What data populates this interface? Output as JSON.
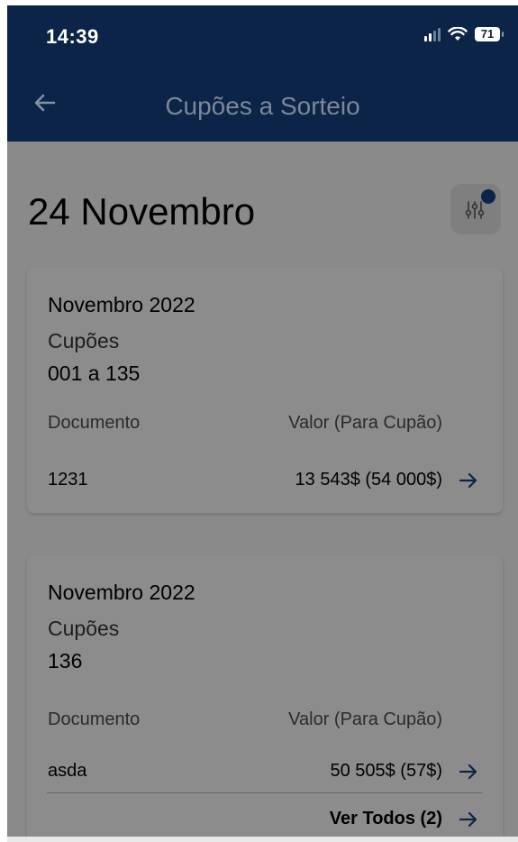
{
  "status": {
    "time": "14:39",
    "battery": "71"
  },
  "header": {
    "title": "Cupões a Sorteio"
  },
  "date_heading": "24 Novembro",
  "cards": [
    {
      "title": "Novembro 2022",
      "coupons_label": "Cupões",
      "coupons_range": "001 a 135",
      "col_document": "Documento",
      "col_value": "Valor (Para Cupão)",
      "document": "1231",
      "value": "13 543$ (54 000$)"
    },
    {
      "title": "Novembro 2022",
      "coupons_label": "Cupões",
      "coupons_range": "136",
      "col_document": "Documento",
      "col_value": "Valor (Para Cupão)",
      "document": "asda",
      "value": "50 505$ (57$)",
      "see_all": "Ver Todos (2)"
    }
  ],
  "colors": {
    "header_bg": "#0b2448",
    "accent": "#0b2448",
    "overlay": "#8a8a8a"
  }
}
